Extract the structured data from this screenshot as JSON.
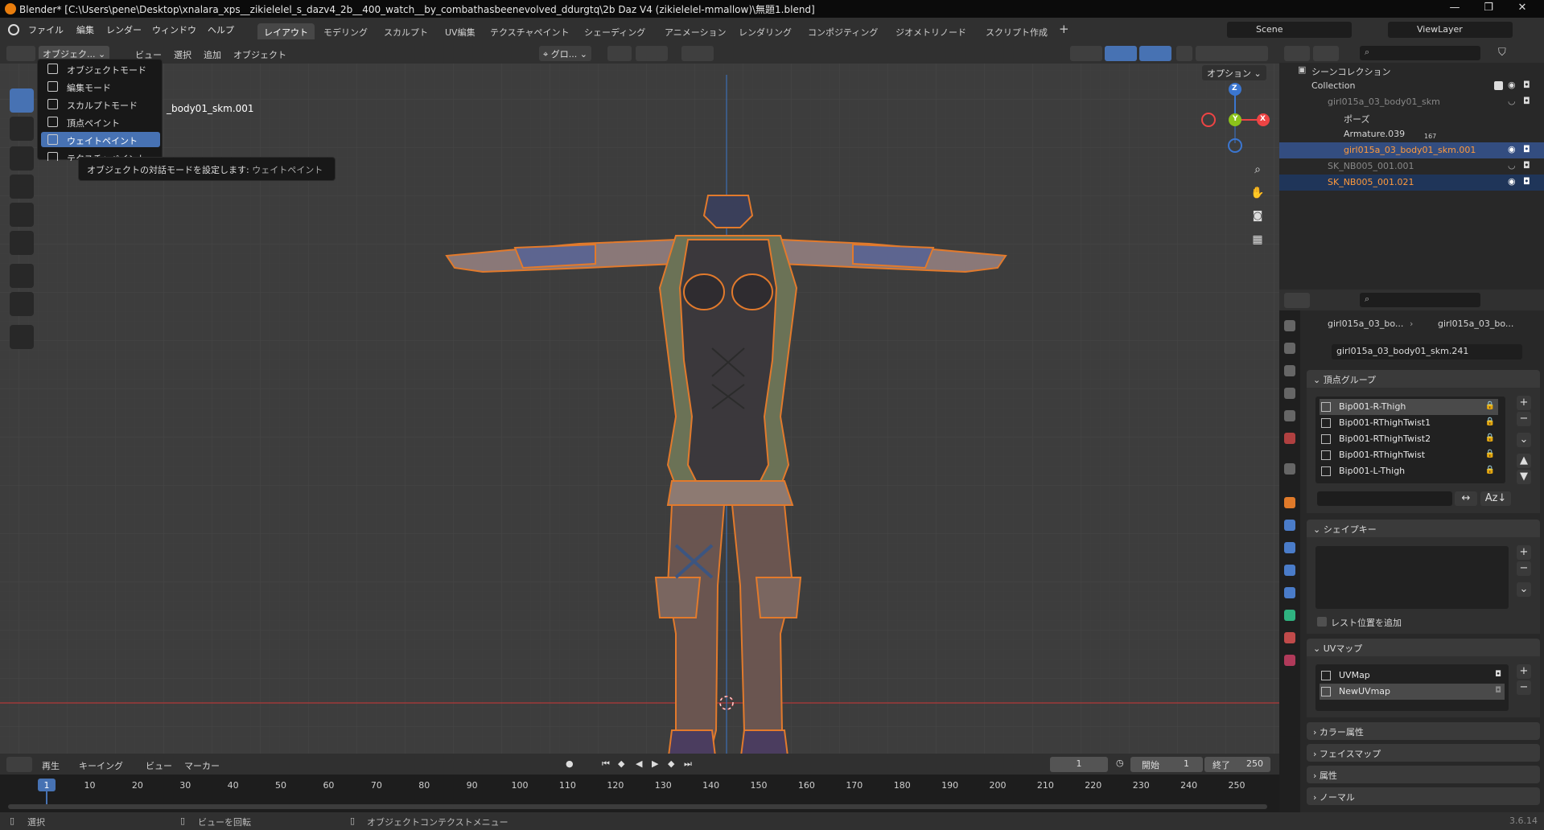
{
  "titlebar": {
    "title": "Blender* [C:\\Users\\pene\\Desktop\\xnalara_xps__zikielelel_s_dazv4_2b__400_watch__by_combathasbeenevolved_ddurgtq\\2b Daz V4 (zikielelel-mmallow)\\無題1.blend]"
  },
  "menu": {
    "file": "ファイル",
    "edit": "編集",
    "render": "レンダー",
    "window": "ウィンドウ",
    "help": "ヘルプ"
  },
  "workspaces": [
    "レイアウト",
    "モデリング",
    "スカルプト",
    "UV編集",
    "テクスチャペイント",
    "シェーディング",
    "アニメーション",
    "レンダリング",
    "コンポジティング",
    "ジオメトリノード",
    "スクリプト作成"
  ],
  "scene": {
    "name": "Scene",
    "viewlayer": "ViewLayer"
  },
  "viewport": {
    "mode_label": "オブジェク...",
    "menu_view": "ビュー",
    "menu_select": "選択",
    "menu_add": "追加",
    "menu_object": "オブジェクト",
    "transform_orient": "グロ...",
    "options": "オプション",
    "object_name": "_body01_skm.001",
    "mode_dropdown": [
      "オブジェクトモード",
      "編集モード",
      "スカルプトモード",
      "頂点ペイント",
      "ウェイトペイント",
      "テクスチャペイント"
    ],
    "selected_mode": "ウェイトペイント",
    "tooltip": "オブジェクトの対話モードを設定します:",
    "tooltip_value": "ウェイトペイント",
    "gizmo": {
      "x": "X",
      "y": "Y",
      "z": "Z"
    }
  },
  "outliner": {
    "root": "シーンコレクション",
    "rows": [
      {
        "label": "Collection"
      },
      {
        "label": "girl015a_03_body01_skm"
      },
      {
        "label": "ポーズ"
      },
      {
        "label": "Armature.039",
        "badge": "167"
      },
      {
        "label": "girl015a_03_body01_skm.001"
      },
      {
        "label": "SK_NB005_001.001"
      },
      {
        "label": "SK_NB005_001.021"
      }
    ]
  },
  "properties": {
    "breadcrumb1": "girl015a_03_bo...",
    "breadcrumb2": "girl015a_03_bo...",
    "mesh_name": "girl015a_03_body01_skm.241",
    "vertex_groups_title": "頂点グループ",
    "vertex_groups": [
      "Bip001-R-Thigh",
      "Bip001-RThighTwist1",
      "Bip001-RThighTwist2",
      "Bip001-RThighTwist",
      "Bip001-L-Thigh"
    ],
    "shape_keys_title": "シェイプキー",
    "rest_position": "レスト位置を追加",
    "uv_maps_title": "UVマップ",
    "uv_maps": [
      "UVMap",
      "NewUVmap"
    ],
    "color_attr": "カラー属性",
    "face_maps": "フェイスマップ",
    "attributes": "属性",
    "normals": "ノーマル"
  },
  "timeline": {
    "play": "再生",
    "keying": "キーイング",
    "view": "ビュー",
    "marker": "マーカー",
    "current_frame": "1",
    "start_label": "開始",
    "start": "1",
    "end_label": "終了",
    "end": "250",
    "ticks": [
      "1",
      "10",
      "20",
      "30",
      "40",
      "50",
      "60",
      "70",
      "80",
      "90",
      "100",
      "110",
      "120",
      "130",
      "140",
      "150",
      "160",
      "170",
      "180",
      "190",
      "200",
      "210",
      "220",
      "230",
      "240",
      "250"
    ]
  },
  "statusbar": {
    "select": "選択",
    "rotate": "ビューを回転",
    "context": "オブジェクトコンテクストメニュー",
    "version": "3.6.14"
  }
}
